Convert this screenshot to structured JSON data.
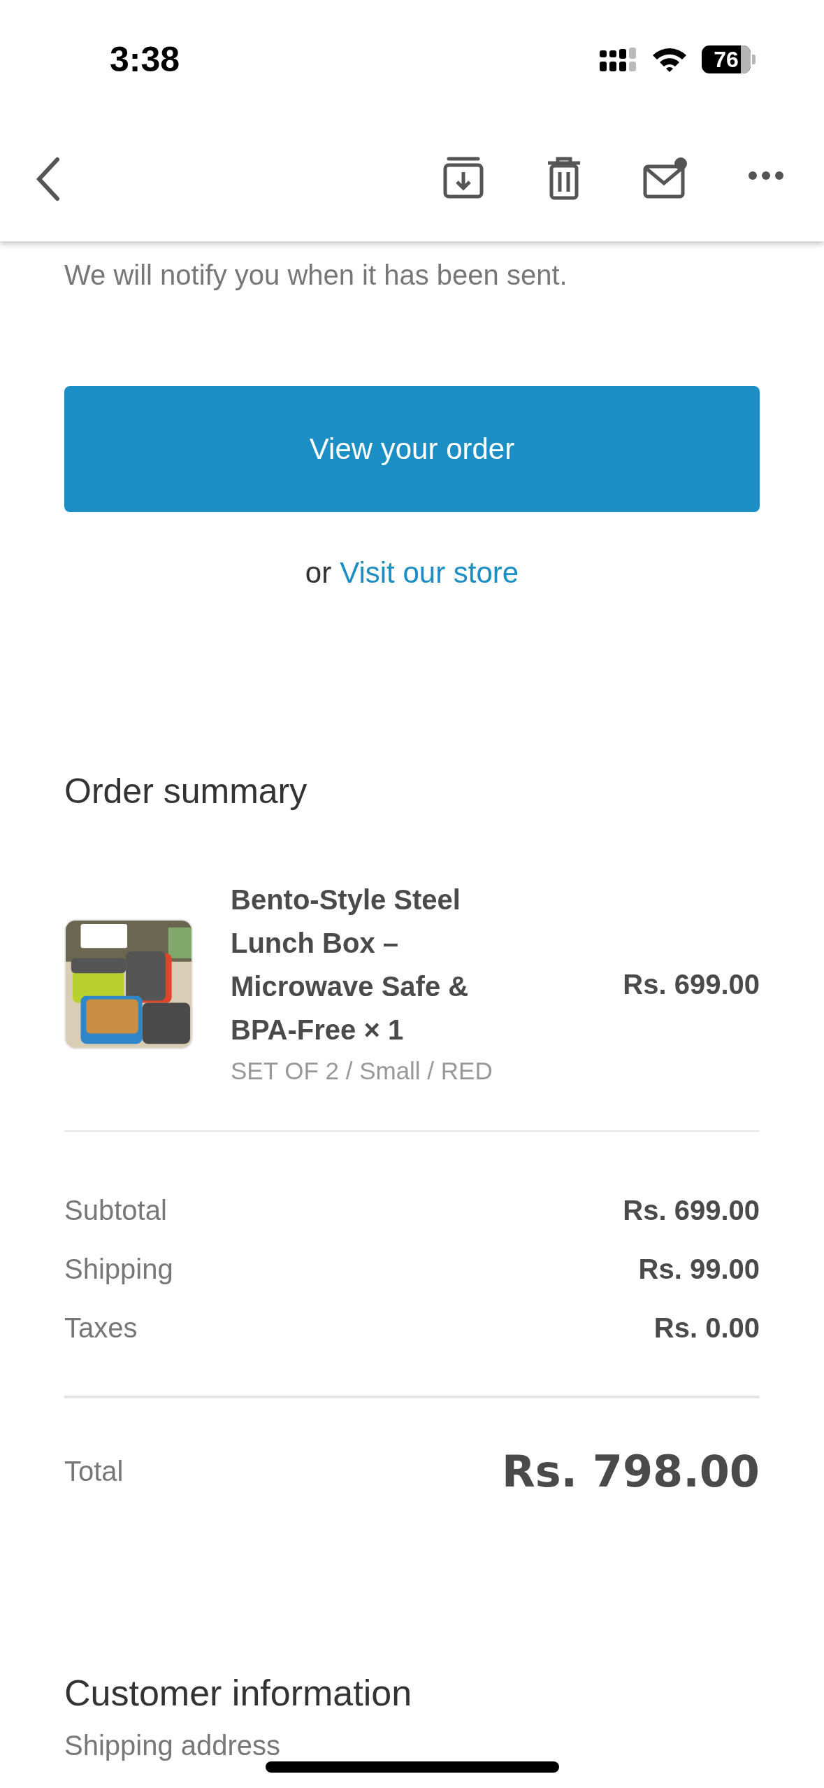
{
  "status_bar": {
    "time": "3:38",
    "battery": "76"
  },
  "email": {
    "message_lines": [
      "We will notify you when it has been sent."
    ],
    "primary_button": "View your order",
    "secondary_prefix": "or",
    "secondary_link": "Visit our store"
  },
  "order_summary": {
    "title": "Order summary",
    "items": [
      {
        "name": "Bento-Style Steel Lunch Box – Microwave Safe & BPA-Free × 1",
        "variant": "SET OF 2 / Small / RED",
        "price": "Rs. 699.00"
      }
    ],
    "lines": [
      {
        "label": "Subtotal",
        "value": "Rs. 699.00"
      },
      {
        "label": "Shipping",
        "value": "Rs. 99.00"
      },
      {
        "label": "Taxes",
        "value": "Rs. 0.00"
      }
    ],
    "total": {
      "label": "Total",
      "value": "Rs. 798.00"
    }
  },
  "customer_information": {
    "title": "Customer information",
    "shipping_address_label": "Shipping address"
  }
}
